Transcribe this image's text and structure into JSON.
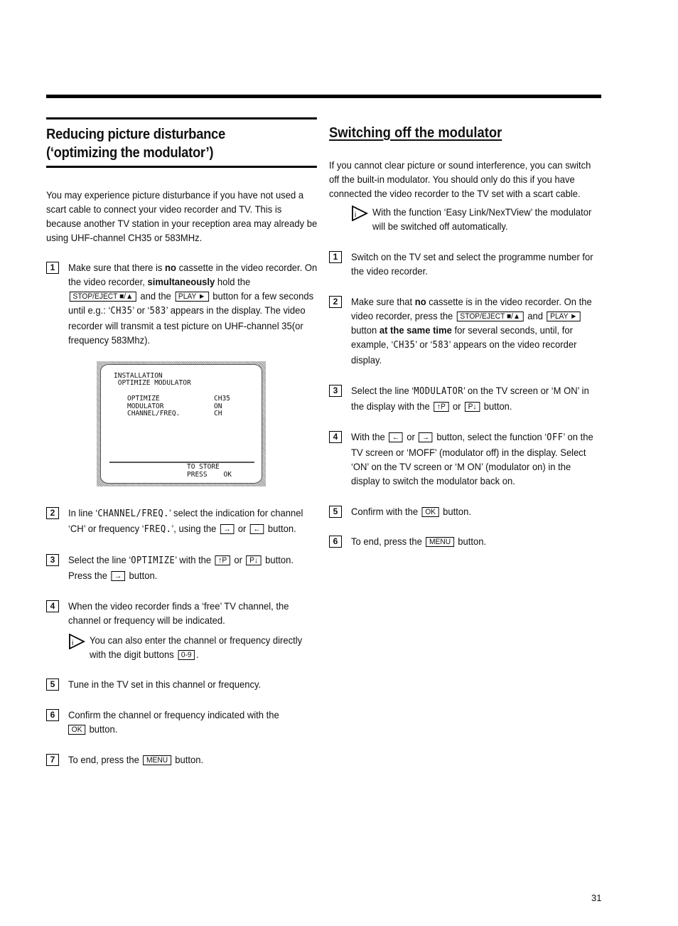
{
  "left": {
    "title_line1": "Reducing picture disturbance",
    "title_line2": "(‘optimizing the modulator’)",
    "intro": "You may experience picture disturbance if you have not used a scart cable to connect your video recorder and TV. This is because another TV station in your reception area may already be using UHF-channel CH35 or 583MHz.",
    "step1": {
      "num": "1",
      "a": "Make sure that there is ",
      "b": "no",
      "c": " cassette in the video recorder. On the video recorder, ",
      "d": "simultaneously",
      "e": " hold the ",
      "key1": "STOP/EJECT ■/▲",
      "f": " and the ",
      "key2": "PLAY ►",
      "g": " button for a few seconds until e.g.: ‘",
      "m1": "CH35",
      "h": "’ or ‘",
      "m2": "583",
      "i": "’ appears in the display. The video recorder will transmit a test picture on UHF-channel 35(or frequency 583Mhz)."
    },
    "screen": {
      "title1": "INSTALLATION",
      "title2": " OPTIMIZE MODULATOR",
      "rows": [
        {
          "label": "OPTIMIZE",
          "value": "CH35"
        },
        {
          "label": "MODULATOR",
          "value": "ON"
        },
        {
          "label": "CHANNEL/FREQ.",
          "value": "CH"
        }
      ],
      "footer1": "TO STORE",
      "footer2": "PRESS    OK"
    },
    "step2": {
      "num": "2",
      "a": "In line ‘",
      "m1": "CHANNEL/FREQ.",
      "b": "’ select the indication for channel ‘CH’ or frequency ‘",
      "m2": "FREQ.",
      "c": "’, using the ",
      "key1": "→",
      "d": " or ",
      "key2": "←",
      "e": " button."
    },
    "step3": {
      "num": "3",
      "a": "Select the line ‘",
      "m1": "OPTIMIZE",
      "b": "’ with the ",
      "key1": "↑P",
      "c": " or ",
      "key2": "P↓",
      "d": " button. Press the ",
      "key3": "→",
      "e": " button."
    },
    "step4": {
      "num": "4",
      "text": "When the video recorder finds a ‘free’ TV channel, the channel or frequency will be indicated.",
      "note_a": "You can also enter the channel or frequency directly with the digit buttons ",
      "note_key": "0-9",
      "note_b": "."
    },
    "step5": {
      "num": "5",
      "text": "Tune in the TV set in this channel or frequency."
    },
    "step6": {
      "num": "6",
      "a": "Confirm the channel or frequency indicated with the ",
      "key": "OK",
      "b": " button."
    },
    "step7": {
      "num": "7",
      "a": "To end, press the ",
      "key": "MENU",
      "b": " button."
    }
  },
  "right": {
    "title": "Switching off the modulator",
    "intro": "If you cannot clear picture or sound interference, you can switch off the built-in modulator. You should only do this if you have connected the video recorder to the TV set with a scart cable.",
    "note": "With the function ‘Easy Link/NexTView’ the modulator will be switched off automatically.",
    "step1": {
      "num": "1",
      "text": "Switch on the TV set and select the programme number for the video recorder."
    },
    "step2": {
      "num": "2",
      "a": "Make sure that ",
      "b": "no",
      "c": " cassette is in the video recorder. On the video recorder, press the ",
      "key1": "STOP/EJECT ■/▲",
      "d": " and ",
      "key2": "PLAY ►",
      "e": " button ",
      "f": "at the same time",
      "g": " for several seconds, until, for example, ‘",
      "m1": "CH35",
      "h": "’ or ‘",
      "m2": "583",
      "i": "’ appears on the video recorder display."
    },
    "step3": {
      "num": "3",
      "a": "Select the line ‘",
      "m1": "MODULATOR",
      "b": "’ on the TV screen or ‘M ON’ in the display with the ",
      "key1": "↑P",
      "c": " or ",
      "key2": "P↓",
      "d": " button."
    },
    "step4": {
      "num": "4",
      "a": "With the ",
      "key1": "←",
      "b": " or ",
      "key2": "→",
      "c": " button, select the function ‘",
      "m1": "OFF",
      "d": "’ on the TV screen or ‘MOFF’ (modulator off) in the display. Select ‘ON’ on the TV screen or ‘M ON’ (modulator on) in the display to switch the modulator back on."
    },
    "step5": {
      "num": "5",
      "a": "Confirm with the ",
      "key": "OK",
      "b": " button."
    },
    "step6": {
      "num": "6",
      "a": "To end, press the ",
      "key": "MENU",
      "b": " button."
    }
  },
  "page_number": "31"
}
